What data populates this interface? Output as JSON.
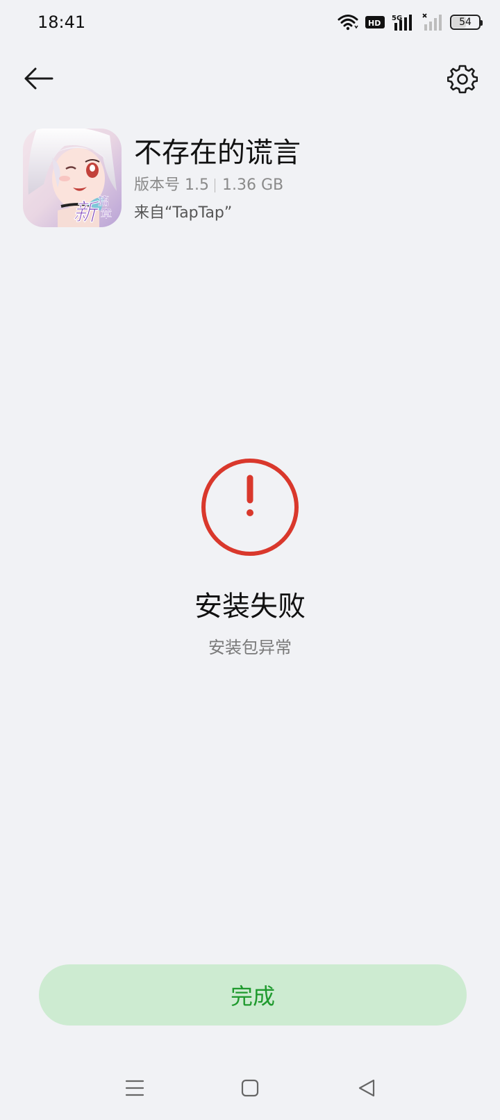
{
  "status_bar": {
    "time": "18:41",
    "battery_level": 54,
    "battery_label": "54",
    "icons": [
      "wifi-icon",
      "hd-icon",
      "5g-signal-icon",
      "no-signal-icon",
      "battery-icon"
    ],
    "hd_label": "HD",
    "network_label": "5G"
  },
  "nav": {
    "back_icon": "arrow-left-icon",
    "settings_icon": "gear-icon"
  },
  "app": {
    "name": "不存在的谎言",
    "version": "版本号 1.5",
    "size": "1.36 GB",
    "source": "来自“TapTap”",
    "icon_badge_text": "新篇章"
  },
  "result": {
    "icon": "exclamation-circle-icon",
    "title": "安装失败",
    "subtitle": "安装包异常"
  },
  "actions": {
    "done_label": "完成"
  },
  "system_nav": {
    "menu_icon": "menu-icon",
    "home_icon": "home-square-icon",
    "back_icon": "back-triangle-icon"
  },
  "colors": {
    "background": "#f1f2f5",
    "error_red": "#d9382c",
    "button_bg": "#cdebd1",
    "button_text": "#1f9a2e"
  }
}
